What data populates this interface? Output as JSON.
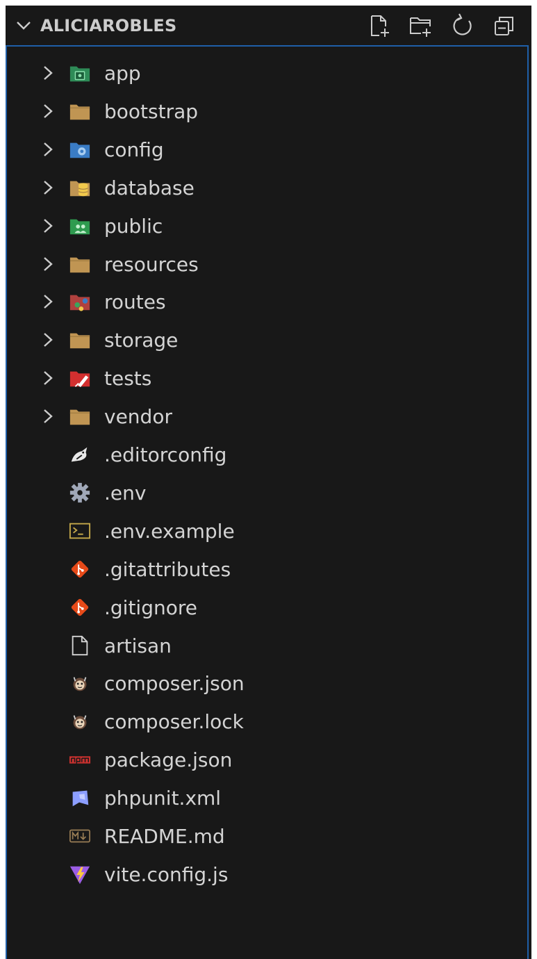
{
  "explorer": {
    "title": "ALICIAROBLES",
    "actions": [
      {
        "icon": "new-file-icon"
      },
      {
        "icon": "new-folder-icon"
      },
      {
        "icon": "refresh-icon"
      },
      {
        "icon": "collapse-all-icon"
      }
    ],
    "folders": [
      {
        "label": "app",
        "icon": "folder-app-icon"
      },
      {
        "label": "bootstrap",
        "icon": "folder-icon"
      },
      {
        "label": "config",
        "icon": "folder-config-icon"
      },
      {
        "label": "database",
        "icon": "folder-database-icon"
      },
      {
        "label": "public",
        "icon": "folder-public-icon"
      },
      {
        "label": "resources",
        "icon": "folder-icon"
      },
      {
        "label": "routes",
        "icon": "folder-routes-icon"
      },
      {
        "label": "storage",
        "icon": "folder-icon"
      },
      {
        "label": "tests",
        "icon": "folder-tests-icon"
      },
      {
        "label": "vendor",
        "icon": "folder-icon"
      }
    ],
    "files": [
      {
        "label": ".editorconfig",
        "icon": "editorconfig-icon"
      },
      {
        "label": ".env",
        "icon": "gear-icon"
      },
      {
        "label": ".env.example",
        "icon": "terminal-icon"
      },
      {
        "label": ".gitattributes",
        "icon": "git-icon"
      },
      {
        "label": ".gitignore",
        "icon": "git-icon"
      },
      {
        "label": "artisan",
        "icon": "file-icon"
      },
      {
        "label": "composer.json",
        "icon": "composer-icon"
      },
      {
        "label": "composer.lock",
        "icon": "composer-icon"
      },
      {
        "label": "package.json",
        "icon": "npm-icon"
      },
      {
        "label": "phpunit.xml",
        "icon": "phpunit-icon"
      },
      {
        "label": "README.md",
        "icon": "markdown-icon"
      },
      {
        "label": "vite.config.js",
        "icon": "vite-icon"
      }
    ]
  },
  "colors": {
    "background": "#181818",
    "text": "#d4d4d4",
    "focus_border": "#1f5fa8",
    "folder": "#c09553"
  }
}
